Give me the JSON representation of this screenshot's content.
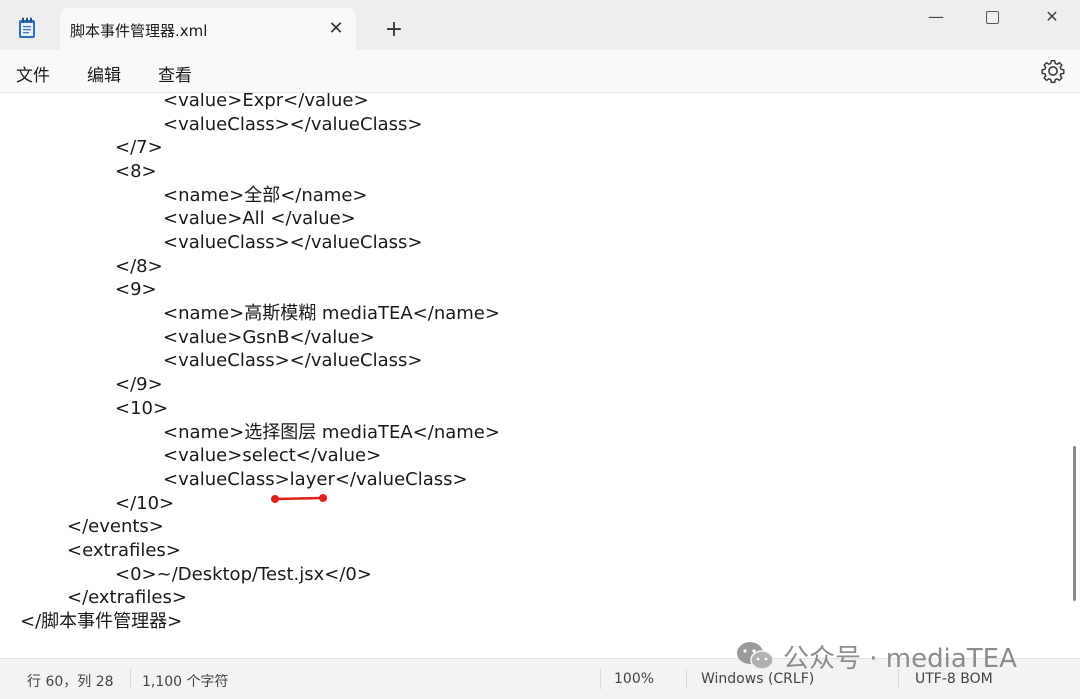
{
  "window": {
    "tab_title": "脚本事件管理器.xml",
    "tab_close": "✕",
    "new_tab": "+",
    "minimize": "—",
    "close": "✕"
  },
  "menu": {
    "file": "文件",
    "edit": "编辑",
    "view": "查看",
    "settings_icon": "gear-icon"
  },
  "editor": {
    "lines": [
      "<value>Expr</value>",
      "<valueClass></valueClass>",
      "</7>",
      "<8>",
      "<name>全部</name>",
      "<value>All </value>",
      "<valueClass></valueClass>",
      "</8>",
      "<9>",
      "<name>高斯模糊 mediaTEA</name>",
      "<value>GsnB</value>",
      "<valueClass></valueClass>",
      "</9>",
      "<10>",
      "<name>选择图层 mediaTEA</name>",
      "<value>select</value>",
      "<valueClass>layer</valueClass>",
      "</10>",
      "</events>",
      "<extrafiles>",
      "<0>~/Desktop/Test.jsx</0>",
      "</extrafiles>",
      "</脚本事件管理器>"
    ],
    "annotation_color": "#e0211b"
  },
  "status": {
    "position": "行 60，列 28",
    "char_count": "1,100 个字符",
    "zoom": "100%",
    "line_ending": "Windows (CRLF)",
    "encoding": "UTF-8 BOM"
  },
  "watermark": {
    "text": "公众号 · mediaTEA"
  }
}
